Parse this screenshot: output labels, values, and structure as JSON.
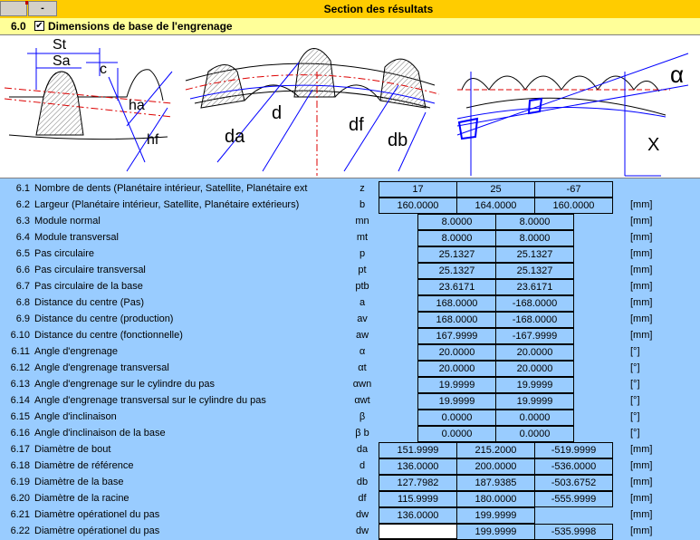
{
  "header": {
    "collapse_label": "-",
    "title": "Section des résultats"
  },
  "section": {
    "number": "6.0",
    "title": "Dimensions de base de l'engrenage",
    "checkbox_mark": "✔"
  },
  "figure": {
    "st": "St",
    "sa": "Sa",
    "c": "c",
    "ha": "ha",
    "hf": "hf",
    "da": "da",
    "d": "d",
    "df": "df",
    "db": "db",
    "alpha": "α",
    "x": "X"
  },
  "rows": [
    {
      "n": "6.1",
      "label": "Nombre de dents (Planétaire intérieur, Satellite, Planétaire extérieurs)",
      "sym": "z",
      "unit": "",
      "v1": "17",
      "v2": "25",
      "v3": "-67",
      "mode": "tri"
    },
    {
      "n": "6.2",
      "label": "Largeur (Planétaire intérieur, Satellite, Planétaire extérieurs)",
      "sym": "b",
      "unit": "[mm]",
      "v1": "160.0000",
      "v2": "164.0000",
      "v3": "160.0000",
      "mode": "tri"
    },
    {
      "n": "6.3",
      "label": "Module normal",
      "sym": "mn",
      "unit": "[mm]",
      "v1": "8.0000",
      "v2": "8.0000",
      "v3": "",
      "mode": "pair"
    },
    {
      "n": "6.4",
      "label": "Module transversal",
      "sym": "mt",
      "unit": "[mm]",
      "v1": "8.0000",
      "v2": "8.0000",
      "v3": "",
      "mode": "pair"
    },
    {
      "n": "6.5",
      "label": "Pas circulaire",
      "sym": "p",
      "unit": "[mm]",
      "v1": "25.1327",
      "v2": "25.1327",
      "v3": "",
      "mode": "pair"
    },
    {
      "n": "6.6",
      "label": "Pas circulaire transversal",
      "sym": "pt",
      "unit": "[mm]",
      "v1": "25.1327",
      "v2": "25.1327",
      "v3": "",
      "mode": "pair"
    },
    {
      "n": "6.7",
      "label": "Pas circulaire de la base",
      "sym": "ptb",
      "unit": "[mm]",
      "v1": "23.6171",
      "v2": "23.6171",
      "v3": "",
      "mode": "pair"
    },
    {
      "n": "6.8",
      "label": "Distance du centre (Pas)",
      "sym": "a",
      "unit": "[mm]",
      "v1": "168.0000",
      "v2": "-168.0000",
      "v3": "",
      "mode": "pair"
    },
    {
      "n": "6.9",
      "label": "Distance du centre (production)",
      "sym": "av",
      "unit": "[mm]",
      "v1": "168.0000",
      "v2": "-168.0000",
      "v3": "",
      "mode": "pair"
    },
    {
      "n": "6.10",
      "label": "Distance du centre (fonctionnelle)",
      "sym": "aw",
      "unit": "[mm]",
      "v1": "167.9999",
      "v2": "-167.9999",
      "v3": "",
      "mode": "pair"
    },
    {
      "n": "6.11",
      "label": "Angle d'engrenage",
      "sym": "α",
      "unit": "[°]",
      "v1": "20.0000",
      "v2": "20.0000",
      "v3": "",
      "mode": "pair"
    },
    {
      "n": "6.12",
      "label": "Angle d'engrenage transversal",
      "sym": "αt",
      "unit": "[°]",
      "v1": "20.0000",
      "v2": "20.0000",
      "v3": "",
      "mode": "pair"
    },
    {
      "n": "6.13",
      "label": "Angle d'engrenage sur le cylindre du pas",
      "sym": "αwn",
      "unit": "[°]",
      "v1": "19.9999",
      "v2": "19.9999",
      "v3": "",
      "mode": "pair"
    },
    {
      "n": "6.14",
      "label": "Angle d'engrenage transversal sur le cylindre du pas",
      "sym": "αwt",
      "unit": "[°]",
      "v1": "19.9999",
      "v2": "19.9999",
      "v3": "",
      "mode": "pair"
    },
    {
      "n": "6.15",
      "label": "Angle d'inclinaison",
      "sym": "β",
      "unit": "[°]",
      "v1": "0.0000",
      "v2": "0.0000",
      "v3": "",
      "mode": "pair"
    },
    {
      "n": "6.16",
      "label": "Angle d'inclinaison de la base",
      "sym": "β b",
      "unit": "[°]",
      "v1": "0.0000",
      "v2": "0.0000",
      "v3": "",
      "mode": "pair"
    },
    {
      "n": "6.17",
      "label": "Diamètre de bout",
      "sym": "da",
      "unit": "[mm]",
      "v1": "151.9999",
      "v2": "215.2000",
      "v3": "-519.9999",
      "mode": "tri"
    },
    {
      "n": "6.18",
      "label": "Diamètre de référence",
      "sym": "d",
      "unit": "[mm]",
      "v1": "136.0000",
      "v2": "200.0000",
      "v3": "-536.0000",
      "mode": "tri"
    },
    {
      "n": "6.19",
      "label": "Diamètre de la base",
      "sym": "db",
      "unit": "[mm]",
      "v1": "127.7982",
      "v2": "187.9385",
      "v3": "-503.6752",
      "mode": "tri"
    },
    {
      "n": "6.20",
      "label": "Diamètre de la racine",
      "sym": "df",
      "unit": "[mm]",
      "v1": "115.9999",
      "v2": "180.0000",
      "v3": "-555.9999",
      "mode": "tri"
    },
    {
      "n": "6.21",
      "label": "Diamètre opérationel du pas",
      "sym": "dw",
      "unit": "[mm]",
      "v1": "136.0000",
      "v2": "199.9999",
      "v3": "",
      "mode": "first2"
    },
    {
      "n": "6.22",
      "label": "Diamètre opérationel du pas",
      "sym": "dw",
      "unit": "[mm]",
      "v1": "",
      "v2": "199.9999",
      "v3": "-535.9998",
      "mode": "last2"
    }
  ]
}
